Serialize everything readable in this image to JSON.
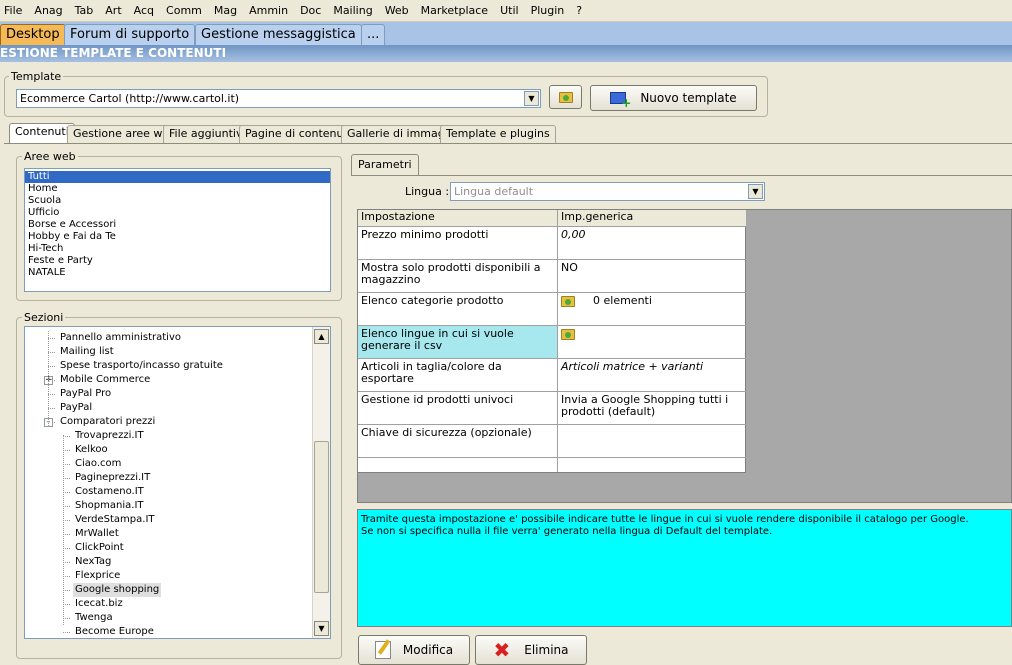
{
  "menu": [
    "File",
    "Anag",
    "Tab",
    "Art",
    "Acq",
    "Comm",
    "Mag",
    "Ammin",
    "Doc",
    "Mailing",
    "Web",
    "Marketplace",
    "Util",
    "Plugin",
    "?"
  ],
  "tabs": [
    "Desktop",
    "Forum di supporto",
    "Gestione messaggistica",
    "..."
  ],
  "banner": "ESTIONE TEMPLATE E CONTENUTI",
  "template": {
    "group_label": "Template",
    "selected": "Ecommerce Cartol (http://www.cartol.it)",
    "new_button": "Nuovo template"
  },
  "subtabs": [
    "Contenuti",
    "Gestione aree web",
    "File aggiuntivi",
    "Pagine di contenuti",
    "Gallerie di immagini",
    "Template e plugins"
  ],
  "aree_web": {
    "label": "Aree web",
    "items": [
      "Tutti",
      "Home",
      "Scuola",
      "Ufficio",
      "Borse e Accessori",
      "Hobby e Fai da Te",
      "Hi-Tech",
      "Feste e Party",
      "NATALE"
    ]
  },
  "sezioni": {
    "label": "Sezioni",
    "items": [
      {
        "text": "Pannello amministrativo",
        "level": 0,
        "expander": ""
      },
      {
        "text": "Mailing list",
        "level": 0,
        "expander": ""
      },
      {
        "text": "Spese trasporto/incasso gratuite",
        "level": 0,
        "expander": ""
      },
      {
        "text": "Mobile Commerce",
        "level": 0,
        "expander": "+"
      },
      {
        "text": "PayPal Pro",
        "level": 0,
        "expander": ""
      },
      {
        "text": "PayPal",
        "level": 0,
        "expander": ""
      },
      {
        "text": "Comparatori prezzi",
        "level": 0,
        "expander": "-"
      },
      {
        "text": "Trovaprezzi.IT",
        "level": 1,
        "expander": ""
      },
      {
        "text": "Kelkoo",
        "level": 1,
        "expander": ""
      },
      {
        "text": "Ciao.com",
        "level": 1,
        "expander": ""
      },
      {
        "text": "Pagineprezzi.IT",
        "level": 1,
        "expander": ""
      },
      {
        "text": "Costameno.IT",
        "level": 1,
        "expander": ""
      },
      {
        "text": "Shopmania.IT",
        "level": 1,
        "expander": ""
      },
      {
        "text": "VerdeStampa.IT",
        "level": 1,
        "expander": ""
      },
      {
        "text": "MrWallet",
        "level": 1,
        "expander": ""
      },
      {
        "text": "ClickPoint",
        "level": 1,
        "expander": ""
      },
      {
        "text": "NexTag",
        "level": 1,
        "expander": ""
      },
      {
        "text": "Flexprice",
        "level": 1,
        "expander": ""
      },
      {
        "text": "Google shopping",
        "level": 1,
        "expander": "",
        "selected": true
      },
      {
        "text": "Icecat.biz",
        "level": 1,
        "expander": ""
      },
      {
        "text": "Twenga",
        "level": 1,
        "expander": ""
      },
      {
        "text": "Become Europe",
        "level": 1,
        "expander": ""
      }
    ]
  },
  "parametri": {
    "tab": "Parametri",
    "lingua_label": "Lingua :",
    "lingua_value": "Lingua default",
    "headers": [
      "Impostazione",
      "Imp.generica"
    ],
    "rows": [
      {
        "name": "Prezzo minimo prodotti",
        "value": "0,00",
        "italic": true,
        "folder": false
      },
      {
        "name": "Mostra solo prodotti disponibili a magazzino",
        "value": "NO",
        "italic": false,
        "folder": false
      },
      {
        "name": "Elenco categorie prodotto",
        "value": "0 elementi",
        "italic": false,
        "folder": true
      },
      {
        "name": "Elenco lingue in cui si vuole generare il csv",
        "value": "",
        "italic": false,
        "folder": true,
        "highlight": true
      },
      {
        "name": "Articoli in taglia/colore da esportare",
        "value": "Articoli matrice + varianti",
        "italic": true,
        "folder": false
      },
      {
        "name": "Gestione id prodotti univoci",
        "value": "Invia a Google Shopping tutti i prodotti (default)",
        "italic": false,
        "folder": false
      },
      {
        "name": "Chiave di sicurezza (opzionale)",
        "value": "",
        "italic": false,
        "folder": false
      },
      {
        "name": "",
        "value": "",
        "italic": false,
        "folder": false
      }
    ],
    "help_line1": "Tramite questa impostazione e' possibile indicare tutte le lingue in cui si vuole rendere disponibile il catalogo per Google.",
    "help_line2": "Se non si specifica nulla il file verra' generato nella lingua di Default del template.",
    "modifica": "Modifica",
    "elimina": "Elimina"
  },
  "colors": {
    "help_bg": "#00ffff",
    "highlight": "#a6e8ee",
    "active_tab": "#f5b957",
    "grid_bg": "#a8a8a8"
  }
}
